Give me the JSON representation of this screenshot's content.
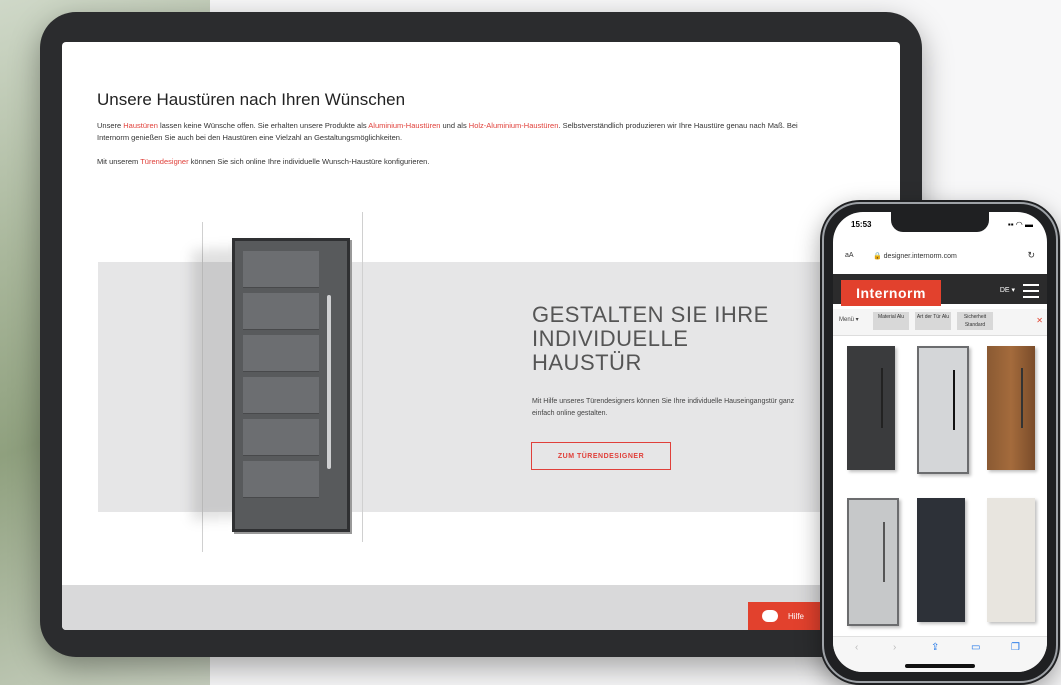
{
  "tablet": {
    "page_title": "Unsere Haustüren nach Ihren Wünschen",
    "paragraph1": {
      "t1": "Unsere ",
      "link1": "Haustüren",
      "t2": " lassen keine Wünsche offen. Sie erhalten unsere Produkte als ",
      "link2": "Aluminium-Haustüren",
      "t3": " und als ",
      "link3": "Holz-Aluminium-Haustüren",
      "t4": ". Selbstverständlich produzieren wir Ihre Haustüre genau nach Maß. Bei Internorm genießen Sie auch bei den Haustüren eine Vielzahl an Gestaltungsmöglichkeiten."
    },
    "paragraph2": {
      "t1": "Mit unserem ",
      "link": "Türendesigner",
      "t2": " können Sie sich online Ihre individuelle Wunsch-Haustüre konfigurieren."
    },
    "hero": {
      "heading": "GESTALTEN SIE IHRE INDIVIDUELLE HAUSTÜR",
      "text": "Mit Hilfe unseres Türendesigners können Sie Ihre individuelle Hauseingangstür ganz einfach online gestalten.",
      "button": "ZUM TÜRENDESIGNER"
    },
    "chat_button": "Hilfe"
  },
  "phone": {
    "time": "15:53",
    "status_icons": "▪▪ ◠ ▬",
    "aa": "aA",
    "url": "🔒 designer.internorm.com",
    "brand": "Internorm",
    "language": "DE ▾",
    "menu_label": "Menü ▾",
    "filters": [
      "Material Alu",
      "Art der Tür Alu",
      "Sicherheit Standard"
    ],
    "close": "✕"
  },
  "colors": {
    "accent": "#e2412d",
    "dark": "#2b2b2c"
  }
}
